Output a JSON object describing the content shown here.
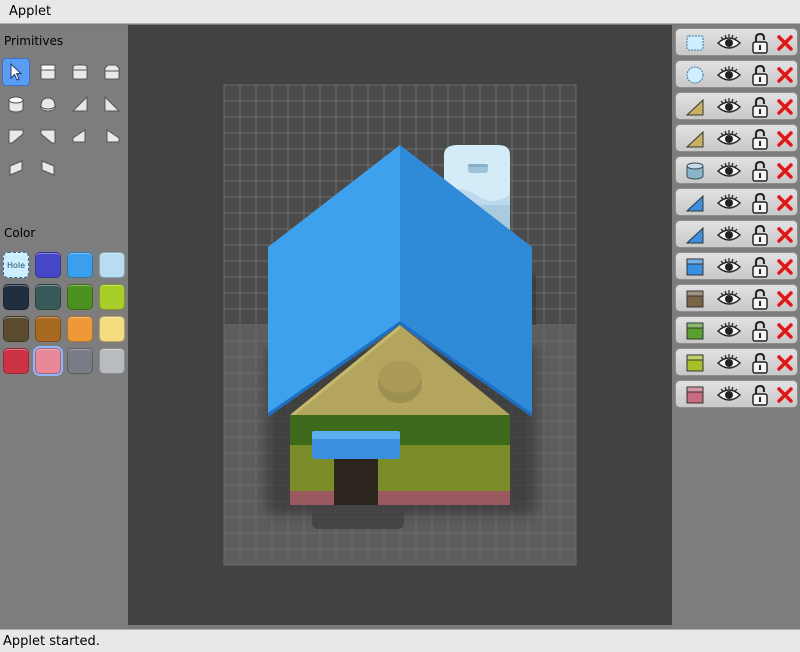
{
  "window": {
    "title": "Applet"
  },
  "status": {
    "text": "Applet started."
  },
  "primitives": {
    "label": "Primitives",
    "tools": [
      {
        "icon": "pointer-icon",
        "selected": true
      },
      {
        "icon": "box-icon"
      },
      {
        "icon": "rounded-box-icon"
      },
      {
        "icon": "beveled-box-icon"
      },
      {
        "icon": "cylinder-icon"
      },
      {
        "icon": "dome-icon"
      },
      {
        "icon": "ramp-left-icon"
      },
      {
        "icon": "ramp-right-icon"
      },
      {
        "icon": "wedge-left-icon"
      },
      {
        "icon": "wedge-right-icon"
      },
      {
        "icon": "slope-left-icon"
      },
      {
        "icon": "slope-right-icon"
      },
      {
        "icon": "corner-left-icon"
      },
      {
        "icon": "corner-right-icon"
      }
    ]
  },
  "color": {
    "label": "Color",
    "hole_label": "Hole",
    "swatches": [
      {
        "value": "hole"
      },
      {
        "value": "#4646c8"
      },
      {
        "value": "#3aa0ee"
      },
      {
        "value": "#b8dcf0"
      },
      {
        "value": "#1f2f40"
      },
      {
        "value": "#3a5a5a"
      },
      {
        "value": "#4c9020"
      },
      {
        "value": "#a8cc28"
      },
      {
        "value": "#5a4a30"
      },
      {
        "value": "#a86a20"
      },
      {
        "value": "#ee9838"
      },
      {
        "value": "#f4dc80"
      },
      {
        "value": "#cc3444"
      },
      {
        "value": "#e88898",
        "selected": true
      },
      {
        "value": "#787c84"
      },
      {
        "value": "#b8bcc0"
      }
    ]
  },
  "layers": [
    {
      "icon": "hole-box-icon",
      "color": "#cfeeff"
    },
    {
      "icon": "hole-cylinder-icon",
      "color": "#cfeeff"
    },
    {
      "icon": "ramp-icon",
      "color": "#c8b060"
    },
    {
      "icon": "ramp-icon",
      "color": "#c8b060"
    },
    {
      "icon": "cylinder-icon",
      "color": "#8ab4cc"
    },
    {
      "icon": "ramp-icon",
      "color": "#3a8fe0"
    },
    {
      "icon": "ramp-icon",
      "color": "#3a8fe0"
    },
    {
      "icon": "box-icon",
      "color": "#3a8fe0"
    },
    {
      "icon": "box-icon",
      "color": "#7a6448"
    },
    {
      "icon": "box-icon",
      "color": "#5aa030"
    },
    {
      "icon": "box-icon",
      "color": "#a8c028"
    },
    {
      "icon": "box-icon",
      "color": "#c86a80"
    }
  ]
}
